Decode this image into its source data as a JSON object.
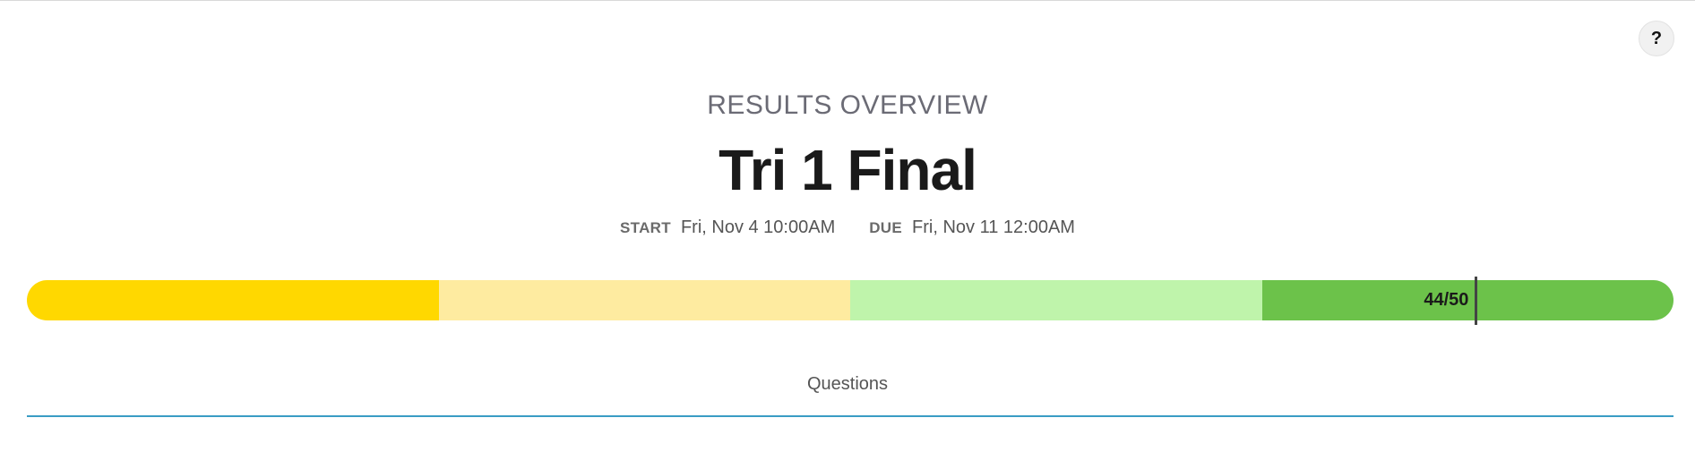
{
  "help_button": {
    "label": "?",
    "icon": "help-icon"
  },
  "header": {
    "subtitle": "RESULTS OVERVIEW",
    "title": "Tri 1 Final",
    "start_label": "START",
    "start_value": "Fri, Nov 4 10:00AM",
    "due_label": "DUE",
    "due_value": "Fri, Nov 11 12:00AM"
  },
  "score": {
    "label": "44/50",
    "value": 44,
    "max": 50,
    "segment_colors": [
      "#ffd800",
      "#feeba0",
      "#bff4ab",
      "#6cc24a"
    ],
    "marker_color": "#444444"
  },
  "tabs": [
    {
      "label": "Questions",
      "active": true,
      "underline_color": "#3a9cc4"
    }
  ]
}
